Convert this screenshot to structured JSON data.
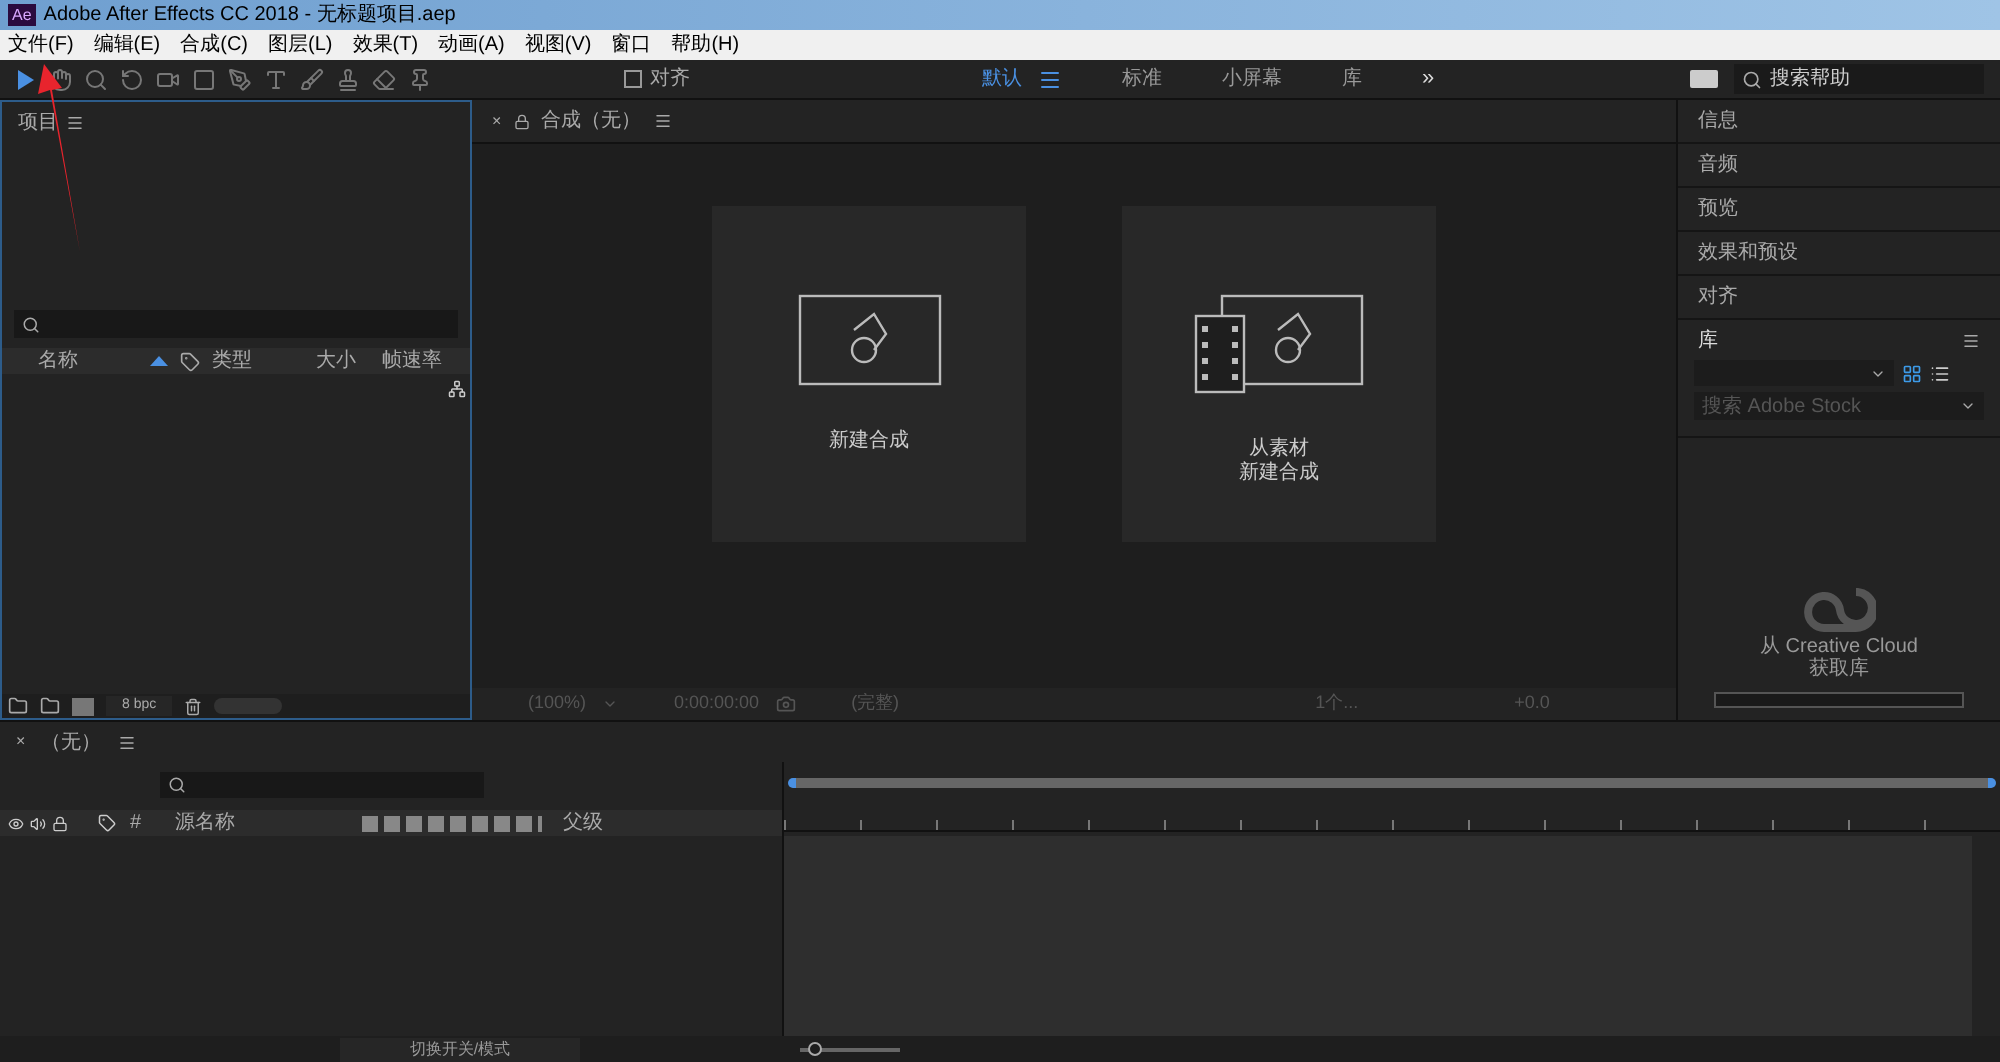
{
  "window": {
    "title": "Adobe After Effects CC 2018 - 无标题项目.aep",
    "logo": "Ae"
  },
  "menu": [
    "文件(F)",
    "编辑(E)",
    "合成(C)",
    "图层(L)",
    "效果(T)",
    "动画(A)",
    "视图(V)",
    "窗口",
    "帮助(H)"
  ],
  "toolbar": {
    "snap": {
      "label": "对齐",
      "checked": false
    },
    "workspaces": [
      {
        "label": "默认",
        "selected": true
      },
      {
        "label": "标准",
        "selected": false
      },
      {
        "label": "小屏幕",
        "selected": false
      },
      {
        "label": "库",
        "selected": false
      }
    ],
    "overflow": "»",
    "search_placeholder": "搜索帮助"
  },
  "project": {
    "title": "项目",
    "columns": [
      "名称",
      "类型",
      "大小",
      "帧速率"
    ],
    "bpc": "8 bpc"
  },
  "composition": {
    "close": "×",
    "tab": "合成（无）",
    "cards": [
      {
        "kind": "new",
        "lines": [
          "新建合成"
        ]
      },
      {
        "kind": "footage",
        "lines": [
          "从素材",
          "新建合成"
        ]
      }
    ],
    "footer": {
      "zoom": "(100%)",
      "timecode": "0:00:00:00",
      "quality": "(完整)",
      "views": "1个...",
      "exposure": "+0.0"
    }
  },
  "panels": [
    "信息",
    "音频",
    "预览",
    "效果和预设",
    "对齐"
  ],
  "library": {
    "title": "库",
    "view_buttons": [
      {
        "kind": "grid",
        "selected": true
      },
      {
        "kind": "list",
        "selected": false
      }
    ],
    "search_placeholder": "搜索 Adobe Stock",
    "message": [
      "从 Creative Cloud",
      "获取库"
    ]
  },
  "timeline": {
    "close": "×",
    "zoom": {
      "level": 0.1
    },
    "tab": "（无）",
    "columns": [
      "#",
      "源名称",
      "父级"
    ],
    "footer": "切换开关/模式"
  }
}
